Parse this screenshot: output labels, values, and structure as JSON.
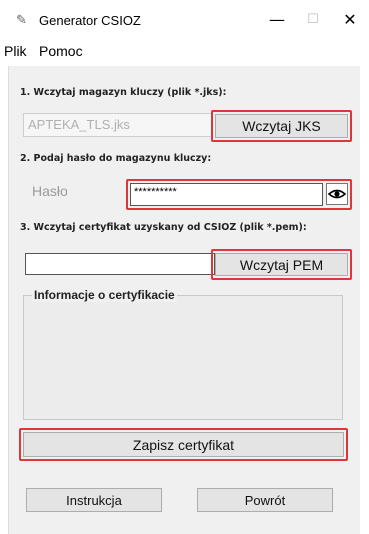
{
  "window": {
    "title": "Generator CSIOZ",
    "minimize": "—",
    "maximize": "☐",
    "close": "✕"
  },
  "menu": {
    "items": [
      "Plik",
      "Pomoc"
    ]
  },
  "step1": {
    "label": "1. Wczytaj magazyn kluczy (plik *.jks):",
    "file_value": "APTEKA_TLS.jks",
    "button": "Wczytaj JKS"
  },
  "step2": {
    "label": "2. Podaj hasło do magazynu kluczy:",
    "password_label": "Hasło",
    "password_value": "**********"
  },
  "step3": {
    "label": "3. Wczytaj certyfikat uzyskany od CSIOZ (plik *.pem):",
    "file_value": "",
    "button": "Wczytaj PEM"
  },
  "info_group": {
    "title": "Informacje o certyfikacie"
  },
  "buttons": {
    "save": "Zapisz certyfikat",
    "instructions": "Instrukcja",
    "back": "Powrót"
  }
}
